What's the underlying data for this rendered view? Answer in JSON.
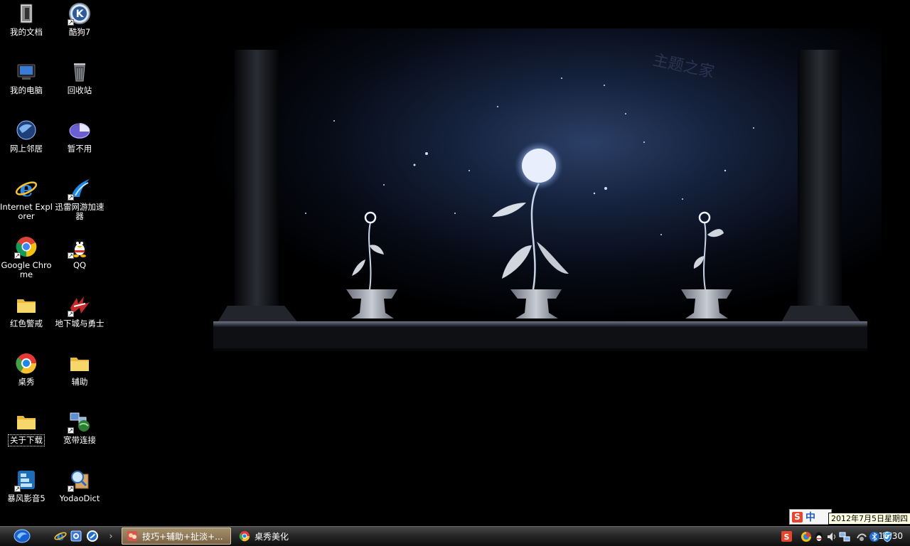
{
  "desktop": {
    "icons": [
      {
        "label": "我的文档",
        "icon": "my-documents-icon",
        "shortcut": false
      },
      {
        "label": "酷狗7",
        "icon": "kugou-icon",
        "shortcut": true
      },
      {
        "label": "我的电脑",
        "icon": "my-computer-icon",
        "shortcut": false
      },
      {
        "label": "回收站",
        "icon": "recycle-bin-icon",
        "shortcut": false
      },
      {
        "label": "网上邻居",
        "icon": "network-places-icon",
        "shortcut": false
      },
      {
        "label": "暂不用",
        "icon": "pie-folder-icon",
        "shortcut": false
      },
      {
        "label": "Internet Explorer",
        "icon": "internet-explorer-icon",
        "shortcut": false
      },
      {
        "label": "迅雷网游加速器",
        "icon": "xunlei-accelerator-icon",
        "shortcut": true
      },
      {
        "label": "Google Chrome",
        "icon": "google-chrome-icon",
        "shortcut": true
      },
      {
        "label": "QQ",
        "icon": "qq-penguin-icon",
        "shortcut": true
      },
      {
        "label": "红色警戒",
        "icon": "folder-icon",
        "shortcut": false
      },
      {
        "label": "地下城与勇士",
        "icon": "dnf-game-icon",
        "shortcut": true
      },
      {
        "label": "桌秀",
        "icon": "zhuoxiu-icon",
        "shortcut": false
      },
      {
        "label": "辅助",
        "icon": "folder-icon",
        "shortcut": false
      },
      {
        "label": "关于下载",
        "icon": "folder-icon",
        "shortcut": false
      },
      {
        "label": "宽带连接",
        "icon": "broadband-connection-icon",
        "shortcut": true
      },
      {
        "label": "暴风影音5",
        "icon": "baofeng-player-icon",
        "shortcut": true
      },
      {
        "label": "YodaoDict",
        "icon": "youdao-dict-icon",
        "shortcut": true
      }
    ]
  },
  "taskbar": {
    "quick_launch": [
      "internet-explorer-icon",
      "show-desktop-icon",
      "sogou-browser-icon"
    ],
    "quick_launch_more": "›",
    "tasks": [
      {
        "label": "技巧+辅助+扯淡+...",
        "icon": "folder-app-icon",
        "active": true
      },
      {
        "label": "桌秀美化",
        "icon": "zhuoxiu-icon",
        "active": false
      }
    ],
    "tray_icons": [
      "sogou-ime-icon",
      "ie-tray-icon",
      "qq-tray-icon",
      "volume-icon",
      "network-icon",
      "update-icon",
      "bluetooth-icon",
      "security-shield-icon"
    ],
    "clock": "16:30"
  },
  "ime": {
    "logo": "S",
    "mode": "中"
  },
  "tooltip": {
    "text": "2012年7月5日星期四"
  },
  "wallpaper": {
    "watermark": "主题之家"
  }
}
